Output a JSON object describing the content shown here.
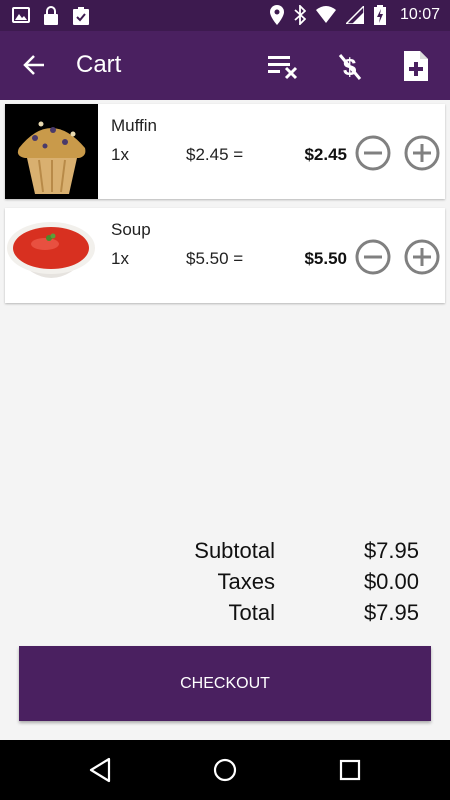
{
  "status_bar": {
    "time": "10:07"
  },
  "app_bar": {
    "title": "Cart",
    "icons": [
      "back-arrow-icon",
      "clear-list-icon",
      "no-money-icon",
      "add-document-icon"
    ]
  },
  "cart": {
    "items": [
      {
        "name": "Muffin",
        "quantity": "1x",
        "unit_price": "$2.45 =",
        "line_total": "$2.45"
      },
      {
        "name": "Soup",
        "quantity": "1x",
        "unit_price": "$5.50 =",
        "line_total": "$5.50"
      }
    ]
  },
  "totals": {
    "subtotal_label": "Subtotal",
    "subtotal_value": "$7.95",
    "taxes_label": "Taxes",
    "taxes_value": "$0.00",
    "total_label": "Total",
    "total_value": "$7.95"
  },
  "checkout": {
    "label": "CHECKOUT"
  },
  "colors": {
    "primary": "#4a2060",
    "status_bar": "#3d1a4f",
    "background": "#f4f4f4"
  }
}
